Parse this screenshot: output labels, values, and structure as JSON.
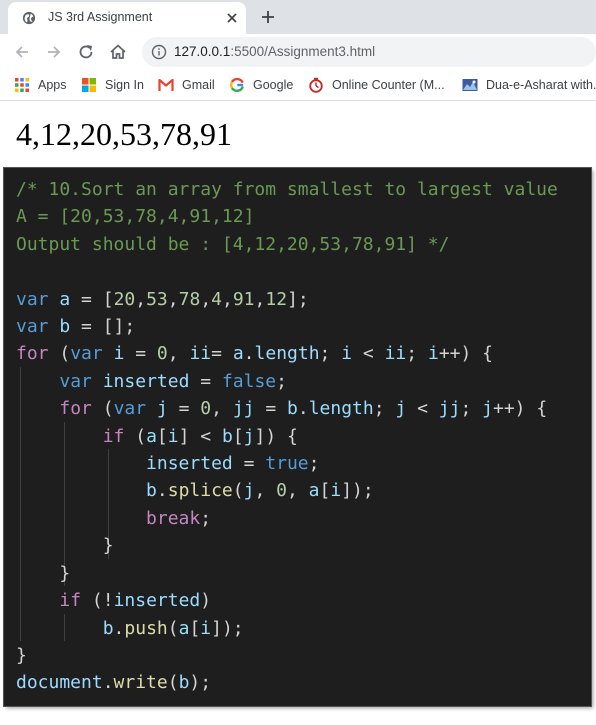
{
  "tab": {
    "title": "JS 3rd Assignment",
    "favicon": "globe-icon"
  },
  "address_bar": {
    "host": "127.0.0.1",
    "path": ":5500/Assignment3.html"
  },
  "bookmarks": [
    {
      "label": "Apps",
      "icon": "apps-grid-icon"
    },
    {
      "label": "Sign In",
      "icon": "windows-logo-icon"
    },
    {
      "label": "Gmail",
      "icon": "gmail-icon"
    },
    {
      "label": "Google",
      "icon": "google-icon"
    },
    {
      "label": "Online Counter (M...",
      "icon": "counter-icon"
    },
    {
      "label": "Dua-e-Asharat with...",
      "icon": "bookmark-image-icon"
    }
  ],
  "page": {
    "output": "4,12,20,53,78,91"
  },
  "code": {
    "lines": [
      [
        [
          "cm",
          "/* 10.Sort an array from smallest to largest value"
        ]
      ],
      [
        [
          "cm",
          "A = [20,53,78,4,91,12]"
        ]
      ],
      [
        [
          "cm",
          "Output should be : [4,12,20,53,78,91] */"
        ]
      ],
      [],
      [
        [
          "kw",
          "var"
        ],
        [
          "pl",
          " "
        ],
        [
          "vr",
          "a"
        ],
        [
          "pl",
          " = ["
        ],
        [
          "nm",
          "20"
        ],
        [
          "pl",
          ","
        ],
        [
          "nm",
          "53"
        ],
        [
          "pl",
          ","
        ],
        [
          "nm",
          "78"
        ],
        [
          "pl",
          ","
        ],
        [
          "nm",
          "4"
        ],
        [
          "pl",
          ","
        ],
        [
          "nm",
          "91"
        ],
        [
          "pl",
          ","
        ],
        [
          "nm",
          "12"
        ],
        [
          "pl",
          "];"
        ]
      ],
      [
        [
          "kw",
          "var"
        ],
        [
          "pl",
          " "
        ],
        [
          "vr",
          "b"
        ],
        [
          "pl",
          " = [];"
        ]
      ],
      [
        [
          "ctl",
          "for"
        ],
        [
          "pl",
          " ("
        ],
        [
          "kw",
          "var"
        ],
        [
          "pl",
          " "
        ],
        [
          "vr",
          "i"
        ],
        [
          "pl",
          " = "
        ],
        [
          "nm",
          "0"
        ],
        [
          "pl",
          ", "
        ],
        [
          "vr",
          "ii"
        ],
        [
          "pl",
          "= "
        ],
        [
          "vr",
          "a"
        ],
        [
          "pl",
          "."
        ],
        [
          "vr",
          "length"
        ],
        [
          "pl",
          "; "
        ],
        [
          "vr",
          "i"
        ],
        [
          "pl",
          " < "
        ],
        [
          "vr",
          "ii"
        ],
        [
          "pl",
          "; "
        ],
        [
          "vr",
          "i"
        ],
        [
          "pl",
          "++) {"
        ]
      ],
      [
        [
          "pl",
          "    "
        ],
        [
          "kw",
          "var"
        ],
        [
          "pl",
          " "
        ],
        [
          "vr",
          "inserted"
        ],
        [
          "pl",
          " = "
        ],
        [
          "kw",
          "false"
        ],
        [
          "pl",
          ";"
        ]
      ],
      [
        [
          "pl",
          "    "
        ],
        [
          "ctl",
          "for"
        ],
        [
          "pl",
          " ("
        ],
        [
          "kw",
          "var"
        ],
        [
          "pl",
          " "
        ],
        [
          "vr",
          "j"
        ],
        [
          "pl",
          " = "
        ],
        [
          "nm",
          "0"
        ],
        [
          "pl",
          ", "
        ],
        [
          "vr",
          "jj"
        ],
        [
          "pl",
          " = "
        ],
        [
          "vr",
          "b"
        ],
        [
          "pl",
          "."
        ],
        [
          "vr",
          "length"
        ],
        [
          "pl",
          "; "
        ],
        [
          "vr",
          "j"
        ],
        [
          "pl",
          " < "
        ],
        [
          "vr",
          "jj"
        ],
        [
          "pl",
          "; "
        ],
        [
          "vr",
          "j"
        ],
        [
          "pl",
          "++) {"
        ]
      ],
      [
        [
          "pl",
          "        "
        ],
        [
          "ctl",
          "if"
        ],
        [
          "pl",
          " ("
        ],
        [
          "vr",
          "a"
        ],
        [
          "pl",
          "["
        ],
        [
          "vr",
          "i"
        ],
        [
          "pl",
          "] < "
        ],
        [
          "vr",
          "b"
        ],
        [
          "pl",
          "["
        ],
        [
          "vr",
          "j"
        ],
        [
          "pl",
          "]) {"
        ]
      ],
      [
        [
          "pl",
          "            "
        ],
        [
          "vr",
          "inserted"
        ],
        [
          "pl",
          " = "
        ],
        [
          "kw",
          "true"
        ],
        [
          "pl",
          ";"
        ]
      ],
      [
        [
          "pl",
          "            "
        ],
        [
          "vr",
          "b"
        ],
        [
          "pl",
          "."
        ],
        [
          "fn",
          "splice"
        ],
        [
          "pl",
          "("
        ],
        [
          "vr",
          "j"
        ],
        [
          "pl",
          ", "
        ],
        [
          "nm",
          "0"
        ],
        [
          "pl",
          ", "
        ],
        [
          "vr",
          "a"
        ],
        [
          "pl",
          "["
        ],
        [
          "vr",
          "i"
        ],
        [
          "pl",
          "]);"
        ]
      ],
      [
        [
          "pl",
          "            "
        ],
        [
          "ctl",
          "break"
        ],
        [
          "pl",
          ";"
        ]
      ],
      [
        [
          "pl",
          "        }"
        ]
      ],
      [
        [
          "pl",
          "    }"
        ]
      ],
      [
        [
          "pl",
          "    "
        ],
        [
          "ctl",
          "if"
        ],
        [
          "pl",
          " (!"
        ],
        [
          "vr",
          "inserted"
        ],
        [
          "pl",
          ")"
        ]
      ],
      [
        [
          "pl",
          "        "
        ],
        [
          "vr",
          "b"
        ],
        [
          "pl",
          "."
        ],
        [
          "fn",
          "push"
        ],
        [
          "pl",
          "("
        ],
        [
          "vr",
          "a"
        ],
        [
          "pl",
          "["
        ],
        [
          "vr",
          "i"
        ],
        [
          "pl",
          "]);"
        ]
      ],
      [
        [
          "pl",
          "}"
        ]
      ],
      [
        [
          "vr",
          "document"
        ],
        [
          "pl",
          "."
        ],
        [
          "fn",
          "write"
        ],
        [
          "pl",
          "("
        ],
        [
          "vr",
          "b"
        ],
        [
          "pl",
          ");"
        ]
      ]
    ]
  }
}
